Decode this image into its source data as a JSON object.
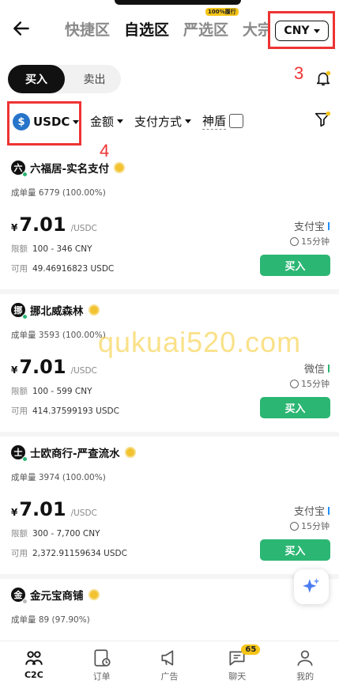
{
  "nav": {
    "tabs": [
      {
        "label": "快捷区"
      },
      {
        "label": "自选区"
      },
      {
        "label": "严选区",
        "badge": "100%履行"
      },
      {
        "label": "大宗"
      }
    ],
    "currency": "CNY"
  },
  "toggle": {
    "buy": "买入",
    "sell": "卖出"
  },
  "annotations": {
    "a3": "3",
    "a4": "4"
  },
  "filters": {
    "coin": "USDC",
    "coin_glyph": "$",
    "amount": "金额",
    "payment": "支付方式",
    "shield": "神盾"
  },
  "listings": [
    {
      "avatar": "六",
      "name": "六福居-实名支付",
      "vol_label": "成单量",
      "volume": "6779 (100.00%)",
      "currency_symbol": "¥",
      "price": "7.01",
      "unit": "/USDC",
      "limit_label": "限额",
      "limit": "100 - 346 CNY",
      "avail_label": "可用",
      "available": "49.46916823 USDC",
      "payment": "支付宝",
      "time": "15分钟",
      "button": "买入",
      "online": true
    },
    {
      "avatar": "挪",
      "name": "挪北威森林",
      "vol_label": "成单量",
      "volume": "3593 (100.00%)",
      "currency_symbol": "¥",
      "price": "7.01",
      "unit": "/USDC",
      "limit_label": "限额",
      "limit": "100 - 599 CNY",
      "avail_label": "可用",
      "available": "414.37599193 USDC",
      "payment": "微信",
      "time": "15分钟",
      "button": "买入",
      "online": true
    },
    {
      "avatar": "士",
      "name": "士欧商行-严查流水",
      "vol_label": "成单量",
      "volume": "3974 (100.00%)",
      "currency_symbol": "¥",
      "price": "7.01",
      "unit": "/USDC",
      "limit_label": "限额",
      "limit": "300 - 7,700 CNY",
      "avail_label": "可用",
      "available": "2,372.91159634 USDC",
      "payment": "支付宝",
      "time": "15分钟",
      "button": "买入",
      "online": true
    },
    {
      "avatar": "金",
      "name": "金元宝商铺",
      "vol_label": "成单量",
      "volume": "89 (97.90%)",
      "online": false
    }
  ],
  "watermark": "qukuai520.com",
  "bottom_nav": [
    {
      "label": "C2C",
      "icon": "people-icon"
    },
    {
      "label": "订单",
      "icon": "order-icon"
    },
    {
      "label": "广告",
      "icon": "megaphone-icon"
    },
    {
      "label": "聊天",
      "icon": "chat-icon",
      "count": "65"
    },
    {
      "label": "我的",
      "icon": "profile-icon"
    }
  ],
  "colors": {
    "accent_green": "#2bb673",
    "annotation_red": "#ee3333",
    "badge_yellow": "#f5c518"
  }
}
